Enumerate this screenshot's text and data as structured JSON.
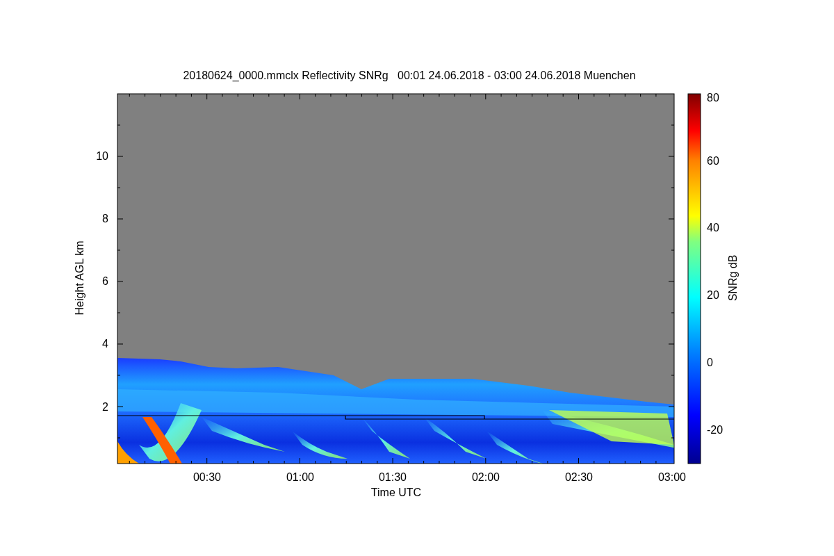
{
  "title": "20180624_0000.mmclx Reflectivity SNRg   00:01 24.06.2018 - 03:00 24.06.2018 Muenchen",
  "xaxis": {
    "label": "Time UTC",
    "ticks": [
      "00:30",
      "01:00",
      "01:30",
      "02:00",
      "02:30",
      "03:00"
    ]
  },
  "yaxis": {
    "label": "Height AGL km",
    "ticks": [
      "10",
      "8",
      "6",
      "4",
      "2"
    ]
  },
  "colorbar": {
    "label": "SNRg dB",
    "ticks": [
      "80",
      "60",
      "40",
      "20",
      "0",
      "-20"
    ]
  }
}
